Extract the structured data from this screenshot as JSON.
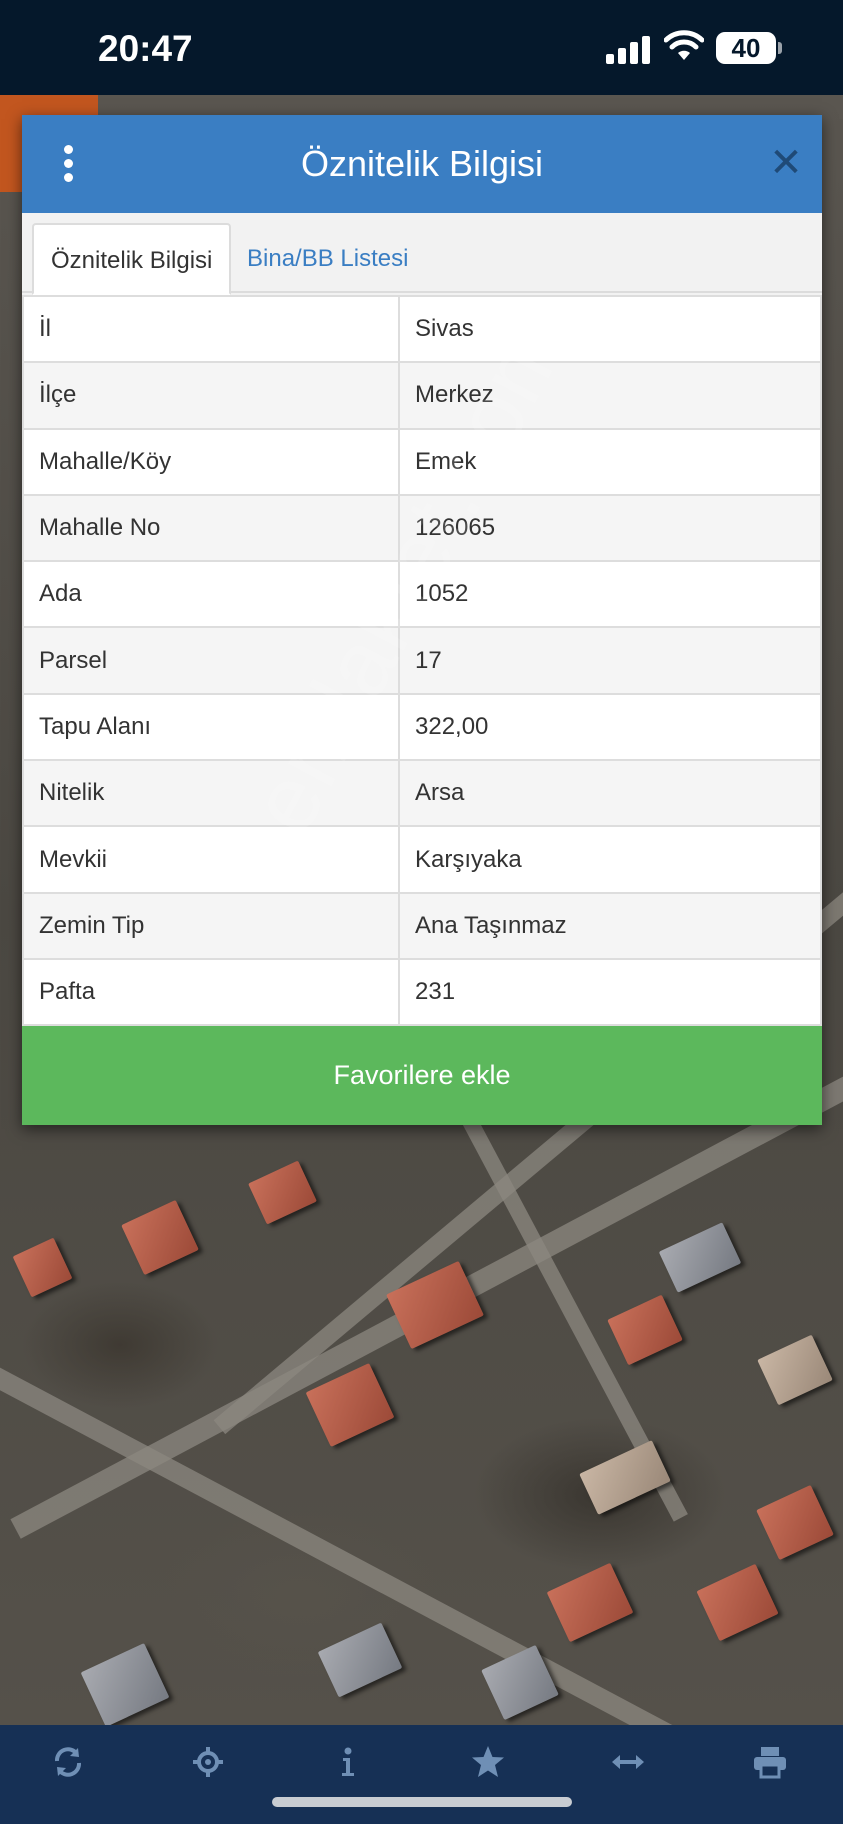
{
  "status_bar": {
    "time": "20:47",
    "battery": "40"
  },
  "dialog": {
    "title": "Öznitelik Bilgisi",
    "tabs": [
      {
        "label": "Öznitelik Bilgisi",
        "active": true
      },
      {
        "label": "Bina/BB Listesi",
        "active": false
      }
    ],
    "rows": [
      {
        "key": "İl",
        "value": "Sivas"
      },
      {
        "key": "İlçe",
        "value": "Merkez"
      },
      {
        "key": "Mahalle/Köy",
        "value": "Emek"
      },
      {
        "key": "Mahalle No",
        "value": "126065"
      },
      {
        "key": "Ada",
        "value": "1052"
      },
      {
        "key": "Parsel",
        "value": "17"
      },
      {
        "key": "Tapu Alanı",
        "value": "322,00"
      },
      {
        "key": "Nitelik",
        "value": "Arsa"
      },
      {
        "key": "Mevkii",
        "value": "Karşıyaka"
      },
      {
        "key": "Zemin Tip",
        "value": "Ana Taşınmaz"
      },
      {
        "key": "Pafta",
        "value": "231"
      }
    ],
    "favorite_button": "Favorilere ekle"
  },
  "watermark": "emlakjet.com",
  "bottom_bar": {
    "icons": [
      "refresh-icon",
      "locate-icon",
      "info-icon",
      "star-icon",
      "measure-icon",
      "print-icon"
    ]
  },
  "colors": {
    "header": "#3a7ec3",
    "favorite_button": "#5cb85c",
    "status_bar": "#05182b",
    "bottom_bar": "#163055"
  }
}
